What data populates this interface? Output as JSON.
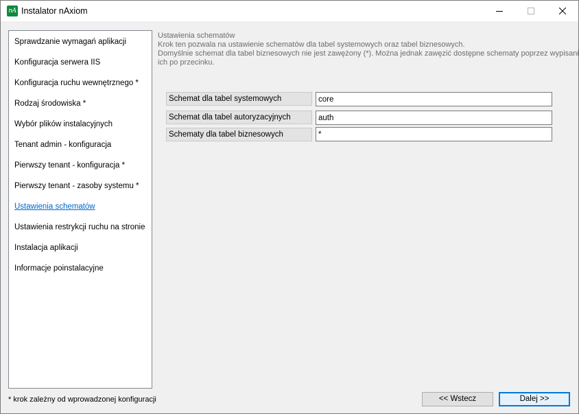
{
  "window": {
    "title": "Instalator nAxiom",
    "icon_text": "nA",
    "controls": {
      "minimize": "minimize-icon",
      "maximize": "maximize-icon",
      "close": "close-icon"
    }
  },
  "sidebar": {
    "items": [
      {
        "label": "Sprawdzanie wymagań aplikacji"
      },
      {
        "label": "Konfiguracja serwera IIS"
      },
      {
        "label": "Konfiguracja ruchu wewnętrznego *"
      },
      {
        "label": "Rodzaj środowiska *"
      },
      {
        "label": "Wybór plików instalacyjnych"
      },
      {
        "label": "Tenant admin - konfiguracja"
      },
      {
        "label": "Pierwszy tenant - konfiguracja *"
      },
      {
        "label": "Pierwszy tenant - zasoby systemu *"
      },
      {
        "label": "Ustawienia schematów",
        "active": true
      },
      {
        "label": "Ustawienia restrykcji ruchu na stronie"
      },
      {
        "label": "Instalacja aplikacji"
      },
      {
        "label": "Informacje poinstalacyjne"
      }
    ],
    "footnote": "* krok zależny od wprowadzonej konfiguracji"
  },
  "main": {
    "section_title": "Ustawienia schematów",
    "description": [
      "Krok ten pozwala na ustawienie schematów dla tabel systemowych oraz tabel biznesowych.",
      "Domyślnie schemat dla tabel biznesowych nie jest zawężony (*). Można jednak zawęzić dostępne schematy poprzez wypisanie",
      "ich po przecinku."
    ],
    "fields": [
      {
        "label": "Schemat dla tabel systemowych",
        "value": "core"
      },
      {
        "label": "Schemat dla tabel autoryzacyjnych",
        "value": "auth"
      },
      {
        "label": "Schematy dla tabel biznesowych",
        "value": "*"
      }
    ]
  },
  "buttons": {
    "back_label": "<< Wstecz",
    "next_label": "Dalej >>"
  },
  "colors": {
    "link_active": "#0066cc",
    "icon_bg": "#0f8a3c",
    "primary_border": "#0078d7",
    "description_text": "#6d6d6d"
  }
}
